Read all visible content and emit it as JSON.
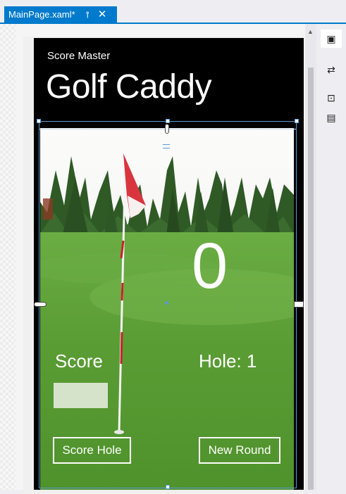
{
  "tab": {
    "title": "MainPage.xaml*",
    "pin_glyph": "⊸",
    "close_glyph": "✕"
  },
  "app": {
    "app_name": "Score Master",
    "page_title": "Golf Caddy",
    "score_value": "0",
    "score_label": "Score",
    "hole_label": "Hole: 1",
    "score_input_value": "",
    "score_hole_button": "Score Hole",
    "new_round_button": "New Round"
  },
  "scroll": {
    "up_arrow": "▲"
  },
  "toolbar": {
    "items": [
      {
        "icon": "device-icon",
        "glyph": "▣"
      },
      {
        "icon": "swap-icon",
        "glyph": "⇄"
      },
      {
        "icon": "code-view-icon",
        "glyph": "⊡"
      },
      {
        "icon": "document-outline-icon",
        "glyph": "▤"
      }
    ]
  },
  "colors": {
    "accent": "#007acc",
    "grass": "#5fa63a",
    "sky": "#f4f4f2",
    "flag": "#d9353f"
  }
}
